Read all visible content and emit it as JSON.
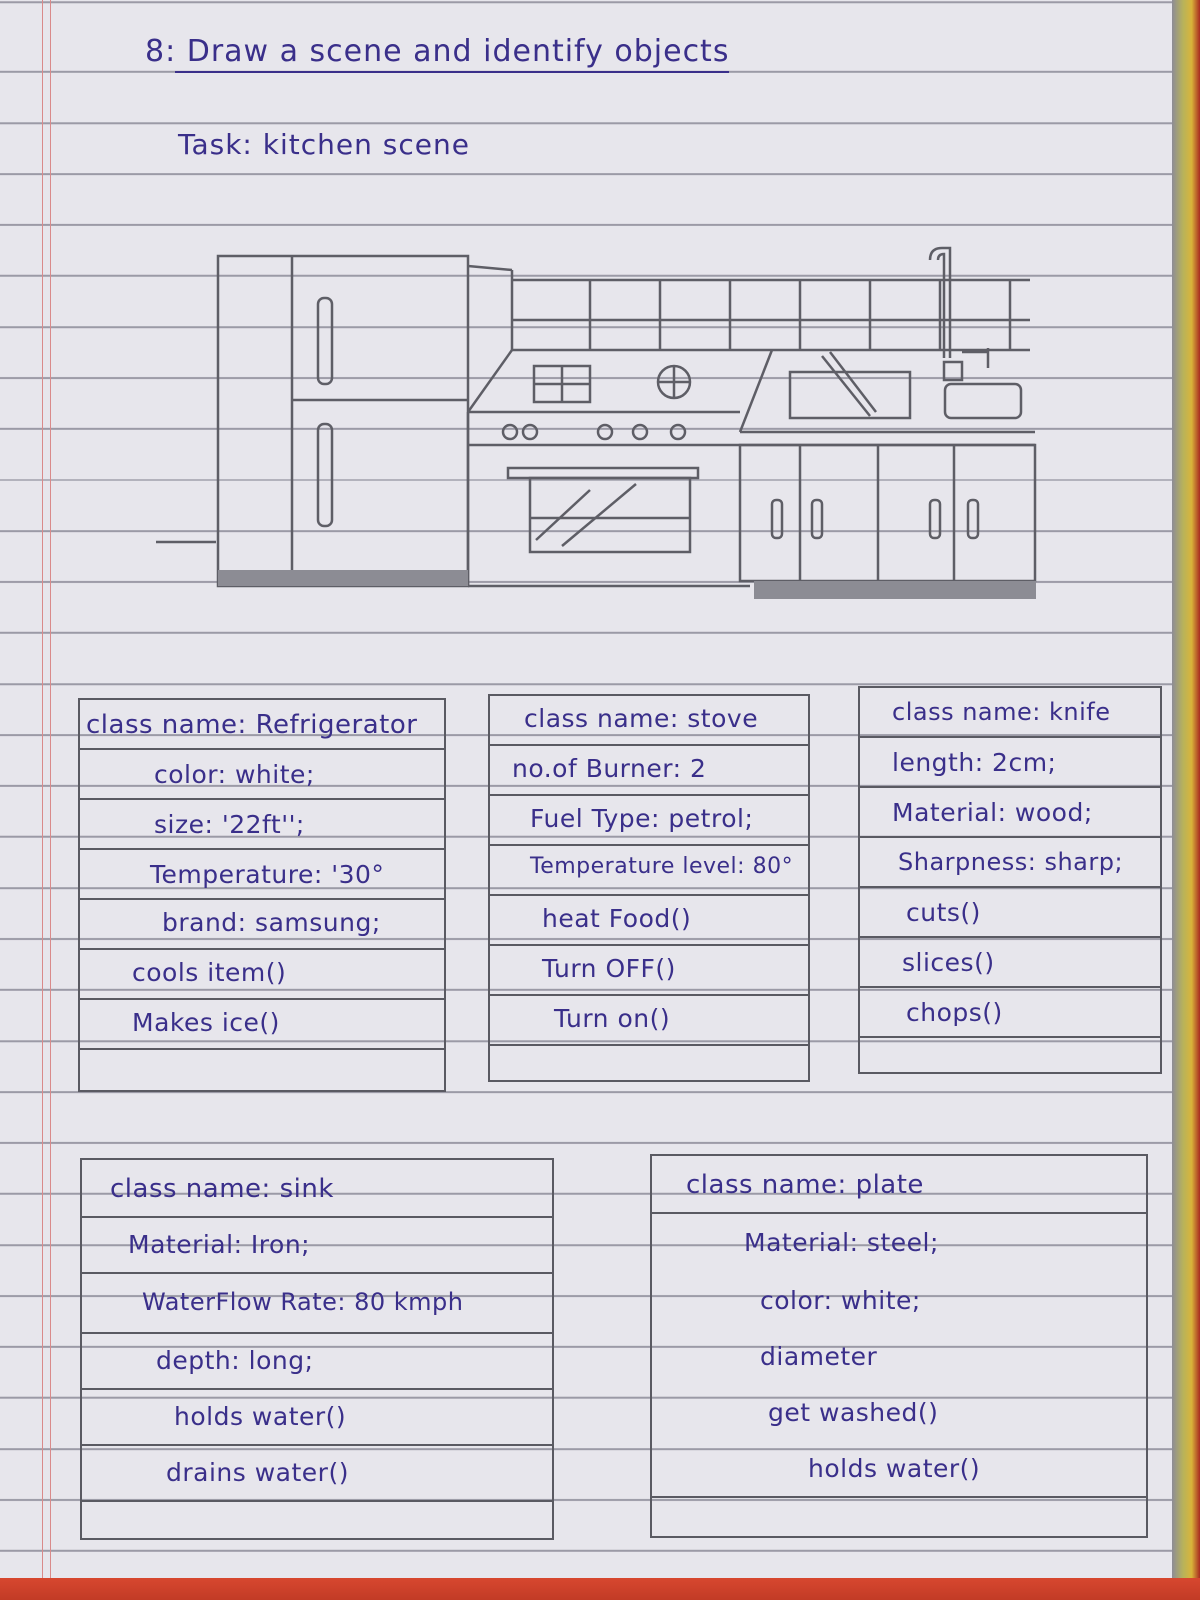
{
  "heading": "8: Draw a scene and identify objects",
  "task": "Task: kitchen scene",
  "tables": {
    "refrigerator": {
      "title": "class name: Refrigerator",
      "rows": [
        "color: white;",
        "size: '22ft'';",
        "Temperature: '30°",
        "brand: samsung;",
        "cools item()",
        "Makes ice()"
      ]
    },
    "stove": {
      "title": "class name: stove",
      "rows": [
        "no.of Burner: 2",
        "Fuel Type: petrol;",
        "Temperature level: 80°",
        "heat Food()",
        "Turn OFF()",
        "Turn on()"
      ]
    },
    "knife": {
      "title": "class name: knife",
      "rows": [
        "length: 2cm;",
        "Material: wood;",
        "Sharpness: sharp;",
        "cuts()",
        "slices()",
        "chops()"
      ]
    },
    "sink": {
      "title": "class name: sink",
      "rows": [
        "Material: Iron;",
        "WaterFlow Rate: 80 kmph",
        "depth: long;",
        "holds water()",
        "drains water()"
      ]
    },
    "plate": {
      "title": "class name: plate",
      "rows": [
        "Material: steel;",
        "color: white;",
        "diameter",
        "get washed()",
        "holds water()"
      ]
    }
  }
}
